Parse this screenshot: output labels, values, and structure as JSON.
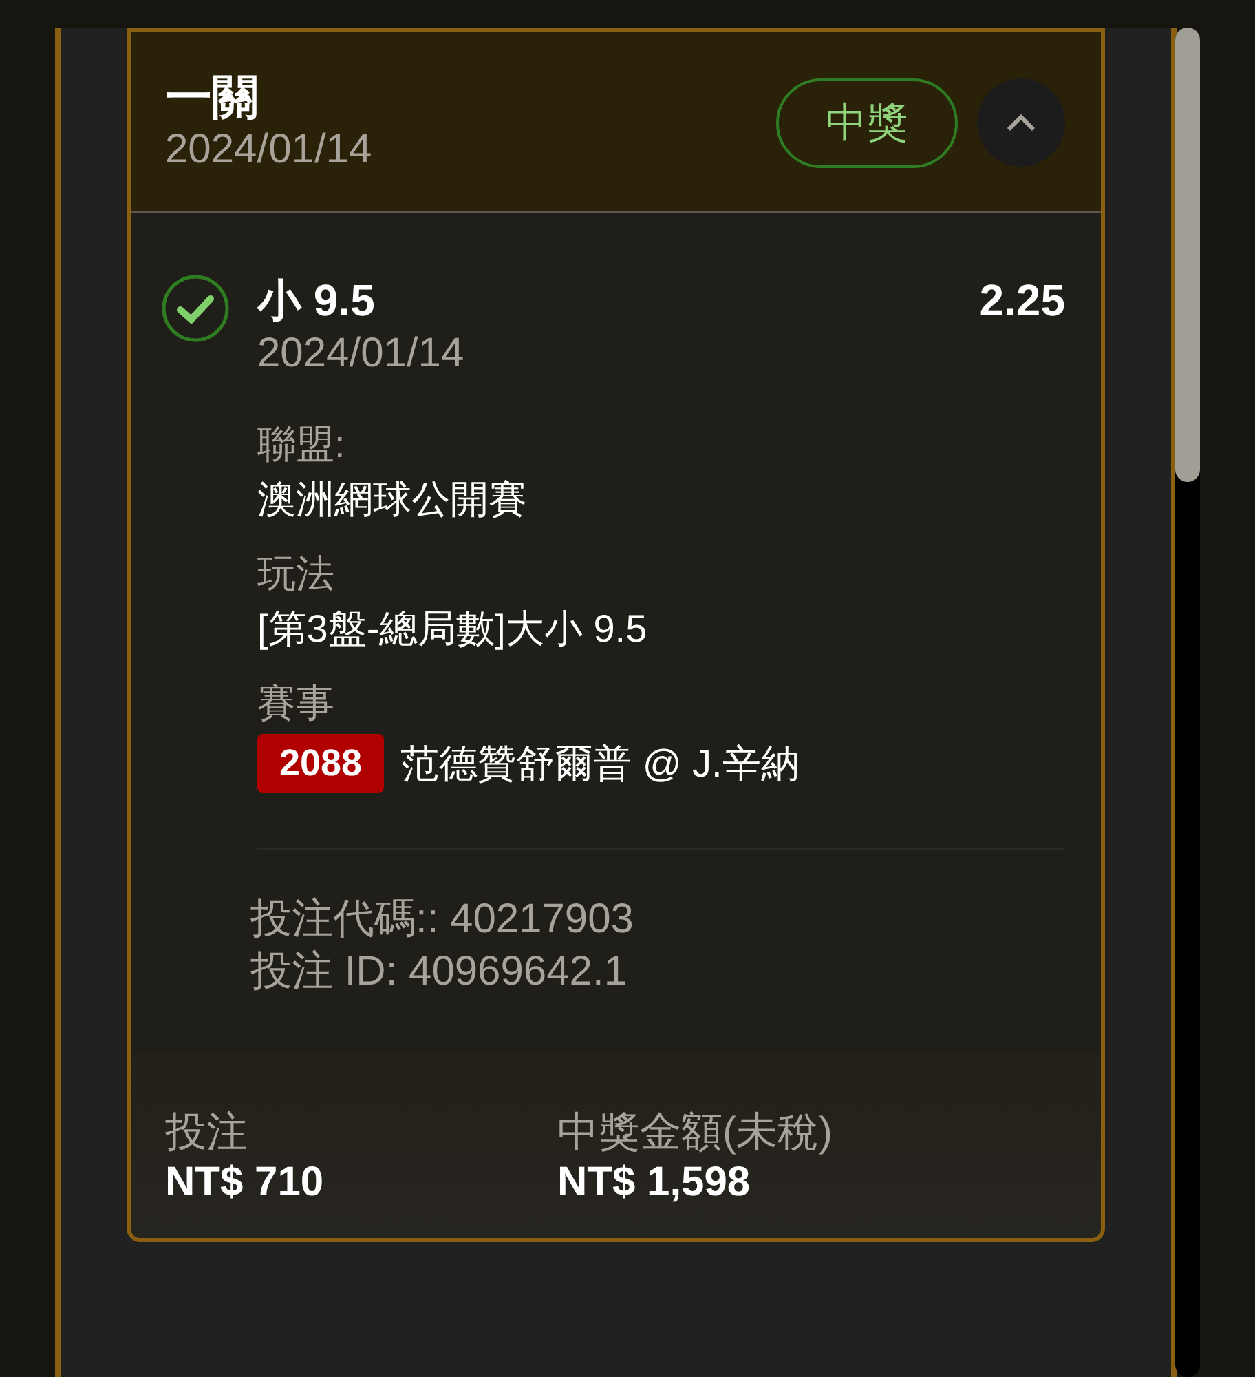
{
  "ticket": {
    "title": "一關",
    "date": "2024/01/14",
    "status": {
      "label": "中獎",
      "won": true
    },
    "expanded": true
  },
  "selection": {
    "checked": true,
    "pick": "小 9.5",
    "date": "2024/01/14",
    "odds": "2.25",
    "details": [
      {
        "label": "聯盟:",
        "value": "澳洲網球公開賽"
      },
      {
        "label": "玩法",
        "value": "[第3盤-總局數]大小 9.5"
      },
      {
        "label": "賽事",
        "badge": "2088",
        "value": "范德贊舒爾普 @ J.辛納"
      }
    ],
    "codes": [
      "投注代碼:: 40217903",
      "投注 ID: 40969642.1"
    ]
  },
  "totals": [
    {
      "label": "投注",
      "amount": "NT$ 710"
    },
    {
      "label": "中獎金額(未稅)",
      "amount": "NT$ 1,598"
    }
  ]
}
